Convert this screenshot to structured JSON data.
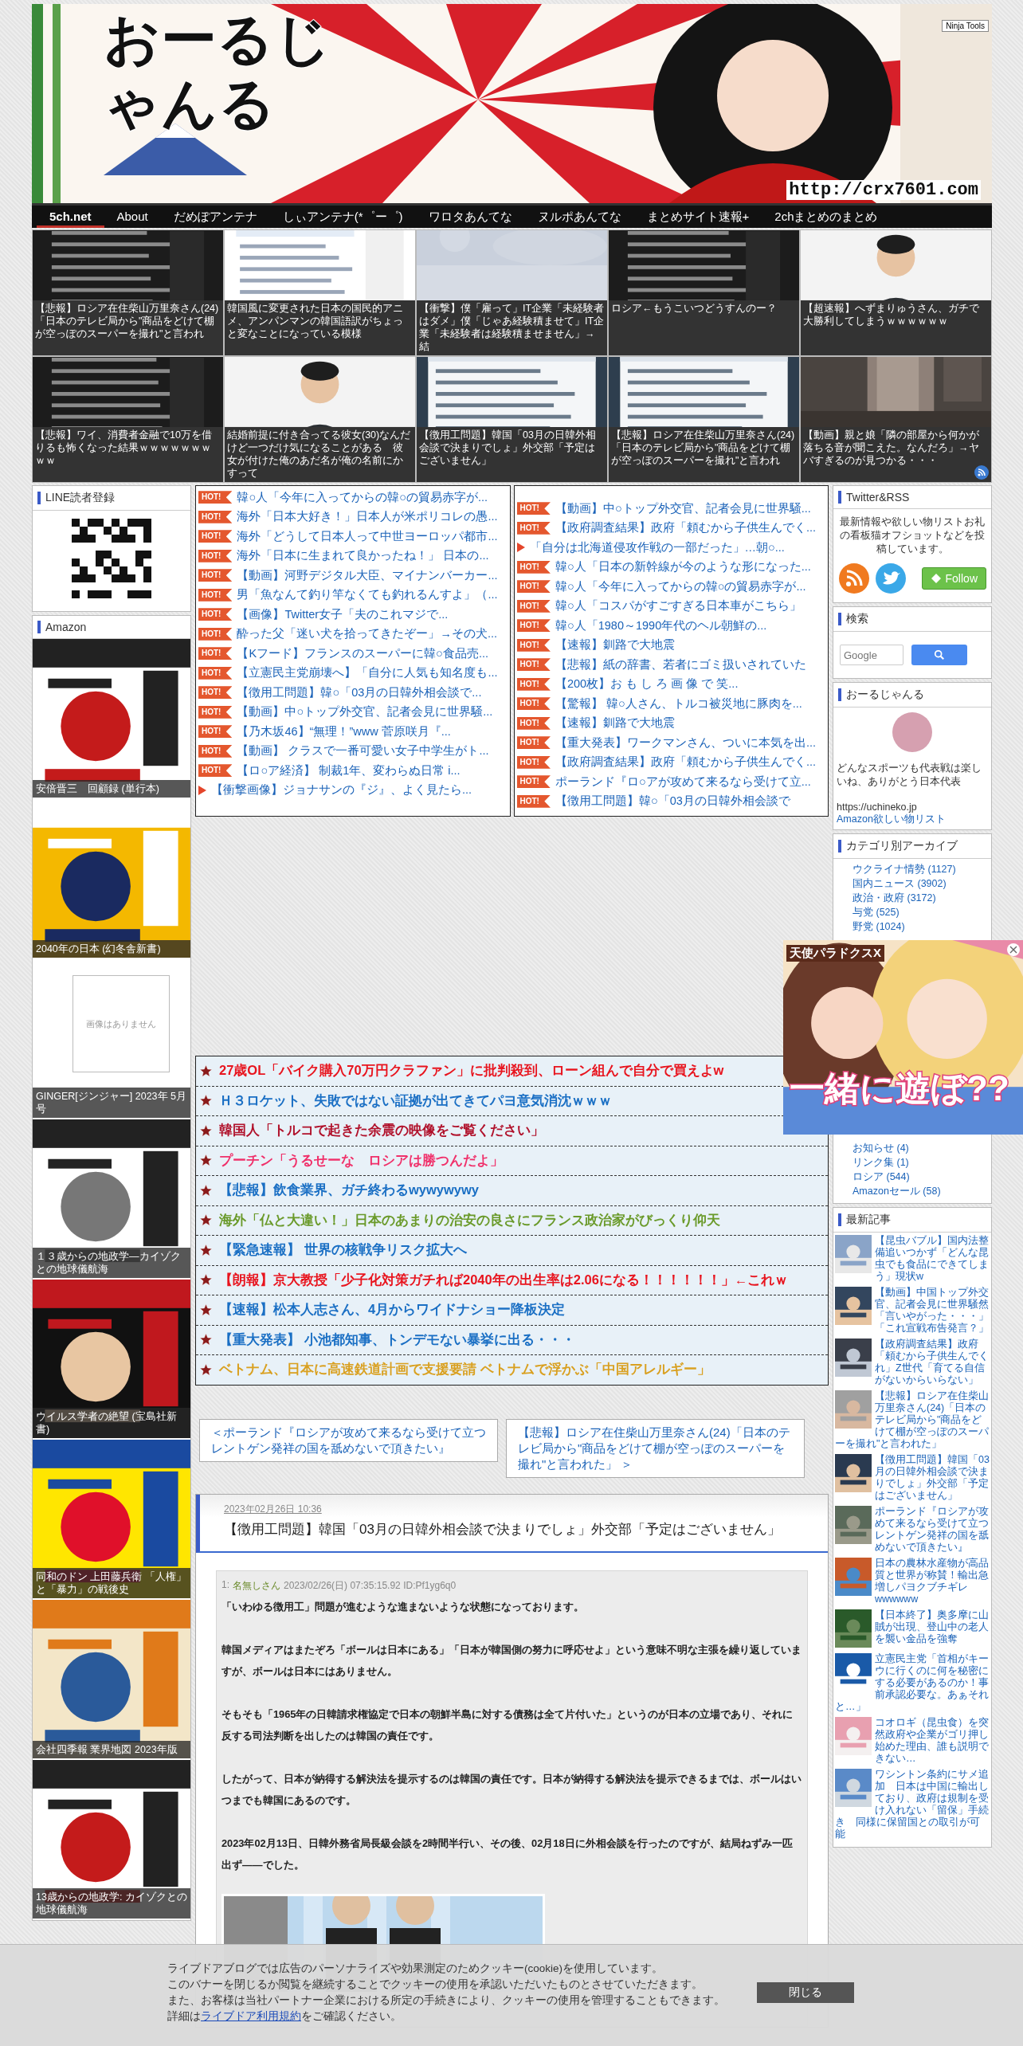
{
  "header": {
    "logo": "おーるじゃんる",
    "url": "http://crx7601.com",
    "badge": "Ninja Tools"
  },
  "nav": {
    "items": [
      {
        "label": "5ch.net",
        "selected": true
      },
      {
        "label": "About",
        "selected": false
      },
      {
        "label": "だめぽアンテナ",
        "selected": false
      },
      {
        "label": "しぃアンテナ(*゜ー゜)",
        "selected": false
      },
      {
        "label": "ワロタあんてな",
        "selected": false
      },
      {
        "label": "ヌルポあんてな",
        "selected": false
      },
      {
        "label": "まとめサイト速報+",
        "selected": false
      },
      {
        "label": "2chまとめのまとめ",
        "selected": false
      }
    ]
  },
  "featured": [
    {
      "caption": "【悲報】ロシア在住柴山万里奈さん(24)「日本のテレビ局から\"商品をどけて棚が空っぽのスーパーを撮れ\"と言われ"
    },
    {
      "caption": "韓国風に変更された日本の国民的アニメ、アンパンマンの韓国語訳がちょっと変なことになっている模様"
    },
    {
      "caption": "【衝撃】僕「雇って」IT企業「未経験者はダメ」僕「じゃあ経験積ませて」IT企業「未経験者は経験積ませません」→結"
    },
    {
      "caption": "ロシア←もうこいつどうすんのー？"
    },
    {
      "caption": "【超速報】へずまりゅうさん、ガチで大勝利してしまうｗｗｗｗｗｗ"
    },
    {
      "caption": "【悲報】ワイ、消費者金融で10万を借りるも怖くなった結果ｗｗｗｗｗｗｗｗｗ"
    },
    {
      "caption": "結婚前提に付き合ってる彼女(30)なんだけど一つだけ気になることがある　彼女が付けた俺のあだ名が俺の名前にかすって"
    },
    {
      "caption": "【徴用工問題】韓国「03月の日韓外相会談で決まりでしょ」外交部「予定はございません」"
    },
    {
      "caption": "【悲報】ロシア在住柴山万里奈さん(24)「日本のテレビ局から\"商品をどけて棚が空っぽのスーパーを撮れ\"と言われ"
    },
    {
      "caption": "【動画】親と娘「隣の部屋から何かが落ちる音が聞こえた。なんだろ」→ヤバすぎるのが見つかる・・・"
    }
  ],
  "hot_lists": [
    {
      "items": [
        {
          "kind": "hot",
          "badge": "HOT!",
          "text": "韓○人「今年に入ってからの韓○の貿易赤字が..."
        },
        {
          "kind": "hot",
          "badge": "HOT!",
          "text": "海外「日本大好き！」日本人が米ポリコレの愚..."
        },
        {
          "kind": "hot",
          "badge": "HOT!",
          "text": "海外「どうして日本人って中世ヨーロッパ都市..."
        },
        {
          "kind": "hot",
          "badge": "HOT!",
          "text": "海外「日本に生まれて良かったね！」 日本の..."
        },
        {
          "kind": "hot",
          "badge": "HOT!",
          "text": "【動画】河野デジタル大臣、マイナンバーカー..."
        },
        {
          "kind": "hot",
          "badge": "HOT!",
          "text": "男「魚なんて釣り竿なくても釣れるんすよ」（..."
        },
        {
          "kind": "hot",
          "badge": "HOT!",
          "text": "【画像】Twitter女子「夫のこれマジで..."
        },
        {
          "kind": "hot",
          "badge": "HOT!",
          "text": "酔った父「迷い犬を拾ってきたぞー」→その犬..."
        },
        {
          "kind": "hot",
          "badge": "HOT!",
          "text": "【Kフード】フランスのスーパーに韓○食品売..."
        },
        {
          "kind": "hot",
          "badge": "HOT!",
          "text": "【立憲民主党崩壊へ】「自分に人気も知名度も..."
        },
        {
          "kind": "hot",
          "badge": "HOT!",
          "text": "【徴用工問題】韓○「03月の日韓外相会談で..."
        },
        {
          "kind": "hot",
          "badge": "HOT!",
          "text": "【動画】中○トップ外交官、記者会見に世界騒..."
        },
        {
          "kind": "hot",
          "badge": "HOT!",
          "text": "【乃木坂46】“無理！”www 菅原咲月『..."
        },
        {
          "kind": "hot",
          "badge": "HOT!",
          "text": "【動画】 クラスで一番可愛い女子中学生がト..."
        },
        {
          "kind": "hot",
          "badge": "HOT!",
          "text": "【ロ○ア経済】 制裁1年、変わらぬ日常 i..."
        },
        {
          "kind": "arrow",
          "text": "【衝撃画像】ジョナサンの『ジ』、よく見たら..."
        }
      ]
    },
    {
      "items": [
        {
          "kind": "hot",
          "badge": "HOT!",
          "text": "【動画】中○トップ外交官、記者会見に世界騒..."
        },
        {
          "kind": "hot",
          "badge": "HOT!",
          "text": "【政府調査結果】政府「頼むから子供生んでく..."
        },
        {
          "kind": "arrow",
          "text": "「自分は北海道侵攻作戦の一部だった」…朝○..."
        },
        {
          "kind": "hot",
          "badge": "HOT!",
          "text": "韓○人「日本の新幹線が今のような形になった..."
        },
        {
          "kind": "hot",
          "badge": "HOT!",
          "text": "韓○人「今年に入ってからの韓○の貿易赤字が..."
        },
        {
          "kind": "hot",
          "badge": "HOT!",
          "text": "韓○人「コスパがすごすぎる日本車がこちら」"
        },
        {
          "kind": "hot",
          "badge": "HOT!",
          "text": "韓○人「1980～1990年代のヘル朝鮮の..."
        },
        {
          "kind": "hot",
          "badge": "HOT!",
          "text": "【速報】釧路で大地震"
        },
        {
          "kind": "hot",
          "badge": "HOT!",
          "text": "【悲報】紙の辞書、若者にゴミ扱いされていた"
        },
        {
          "kind": "hot",
          "badge": "HOT!",
          "text": "【200枚】お も し ろ 画 像 で 笑..."
        },
        {
          "kind": "hot",
          "badge": "HOT!",
          "text": "【驚報】 韓○人さん、トルコ被災地に豚肉を..."
        },
        {
          "kind": "hot",
          "badge": "HOT!",
          "text": "【速報】釧路で大地震"
        },
        {
          "kind": "hot",
          "badge": "HOT!",
          "text": "【重大発表】ワークマンさん、ついに本気を出..."
        },
        {
          "kind": "hot",
          "badge": "HOT!",
          "text": "【政府調査結果】政府「頼むから子供生んでく..."
        },
        {
          "kind": "hot",
          "badge": "HOT!",
          "text": "ポーランド『ロ○アが攻めて来るなら受けて立..."
        },
        {
          "kind": "hot",
          "badge": "HOT!",
          "text": "【徴用工問題】韓○「03月の日韓外相会談で"
        }
      ]
    }
  ],
  "headlines": [
    {
      "text": "27歳OL「バイク購入70万円クラファン」に批判殺到、ローン組んで自分で買えよw",
      "color": "#e8141e"
    },
    {
      "text": "Ｈ３ロケット、失敗ではない証拠が出てきてパヨ意気消沈ｗｗｗ",
      "color": "#1a6fc4"
    },
    {
      "text": "韓国人「トルコで起きた余震の映像をご覧ください」",
      "color": "#b0102a"
    },
    {
      "text": "プーチン「うるせーな　ロシアは勝つんだよ」",
      "color": "#f0306a"
    },
    {
      "text": "【悲報】飲食業界、ガチ終わるwywywywy",
      "color": "#1a6fc4"
    },
    {
      "text": "海外「仏と大違い！」日本のあまりの治安の良さにフランス政治家がびっくり仰天",
      "color": "#6a9a2a"
    },
    {
      "text": "【緊急速報】 世界の核戦争リスク拡大へ",
      "color": "#1a6fc4"
    },
    {
      "text": "【朗報】京大教授「少子化対策ガチれば2040年の出生率は2.06になる！！！！！！」←これｗ",
      "color": "#e8141e"
    },
    {
      "text": "【速報】松本人志さん、4月からワイドナショー降板決定",
      "color": "#1a6fc4"
    },
    {
      "text": "【重大発表】 小池都知事、トンデモない暴挙に出る・・・",
      "color": "#1a6fc4"
    },
    {
      "text": "ベトナム、日本に高速鉄道計画で支援要請 ベトナムで浮かぶ「中国アレルギー」",
      "color": "#d9a020"
    }
  ],
  "pager": {
    "prev": "＜ポーランド『ロシアが攻めて来るなら受けて立つレントゲン発祥の国を舐めないで頂きたい』",
    "next": "【悲報】ロシア在住柴山万里奈さん(24)「日本のテレビ局から\"商品をどけて棚が空っぽのスーパーを撮れ\"と言われた」 ＞"
  },
  "article": {
    "date": "2023年02月26日 10:36",
    "title": "【徴用工問題】韓国「03月の日韓外相会談で決まりでしょ」外交部「予定はございません」",
    "post": {
      "number": "1:",
      "name": "名無しさん",
      "meta": "2023/02/26(日) 07:35:15.92 ID:Pf1yg6q0",
      "paragraphs": [
        "「いわゆる徴用工」問題が進むような進まないような状態になっております。",
        "韓国メディアはまたぞろ「ボールは日本にある」「日本が韓国側の努力に呼応せよ」という意味不明な主張を繰り返していますが、ボールは日本にはありません。",
        "そもそも「1965年の日韓請求権協定で日本の朝鮮半島に対する債務は全て片付いた」というのが日本の立場であり、それに反する司法判断を出したのは韓国の責任です。",
        "したがって、日本が納得する解決法を提示するのは韓国の責任です。日本が納得する解決法を提示できるまでは、ボールはいつまでも韓国にあるのです。",
        "2023年02月13日、日韓外務省局長級会談を2時間半行い、その後、02月18日に外相会談を行ったのですが、結局ねずみ一匹出ず――でした。"
      ]
    }
  },
  "left_sidebar": {
    "line": {
      "title": "LINE読者登録"
    },
    "amazon": {
      "title": "Amazon",
      "books": [
        {
          "kind": "cover",
          "title": "安倍晋三　回顧録 (単行本)"
        },
        {
          "kind": "cover",
          "title": "2040年の日本 (幻冬舎新書)"
        },
        {
          "kind": "no_image",
          "no_image_text": "画像はありません",
          "title": "GINGER[ジンジャー] 2023年 5月号"
        },
        {
          "kind": "cover",
          "title": "１３歳からの地政学―カイゾクとの地球儀航海"
        },
        {
          "kind": "cover",
          "title": "ウイルス学者の絶望 (宝島社新書)"
        },
        {
          "kind": "cover",
          "title": "同和のドン 上田藤兵衛 「人権」と「暴力」の戦後史"
        },
        {
          "kind": "cover",
          "title": "会社四季報 業界地図 2023年版"
        },
        {
          "kind": "cover",
          "title": "13歳からの地政学: カイゾクとの地球儀航海"
        }
      ]
    }
  },
  "right_sidebar": {
    "twitter": {
      "title": "Twitter&RSS",
      "text": "最新情報や欲しい物リストお礼の看板猫オフショットなどを投稿しています。",
      "follow": "Follow"
    },
    "search": {
      "title": "検索",
      "placeholder": "Google"
    },
    "profile": {
      "title": "おーるじゃんる",
      "text": "どんなスポーツも代表戦は楽しいね、ありがとう日本代表",
      "url": "https://uchineko.jp",
      "link": "Amazon欲しい物リスト"
    },
    "categories": {
      "title": "カテゴリ別アーカイブ",
      "items": [
        "ウクライナ情勢 (1127)",
        "国内ニュース (3902)",
        "政治・政府 (3172)",
        "与党 (525)",
        "野党 (1024)"
      ],
      "after_ad": [
        "お知らせ (4)",
        "リンク集 (1)",
        "ロシア (544)",
        "Amazonセール (58)"
      ]
    },
    "latest": {
      "title": "最新記事",
      "items": [
        "【昆虫バブル】国内法整備追いつかず「どんな昆虫でも食品にできてしまう」現状w",
        "【動画】中国トップ外交官、記者会見に世界騒然「言いやがった・・・」「これ宣戦布告発言？」",
        "【政府調査結果】政府「頼むから子供生んでくれ」Z世代「育てる自信がないからいらない」",
        "【悲報】ロシア在住柴山万里奈さん(24)「日本のテレビ局から\"商品をどけて棚が空っぽのスーパーを撮れ\"と言われた」",
        "【徴用工問題】韓国「03月の日韓外相会談で決まりでしょ」外交部「予定はございません」",
        "ポーランド『ロシアが攻めて来るなら受けて立つレントゲン発祥の国を舐めないで頂きたい』",
        "日本の農林水産物が高品質と世界が称賛！輸出急増しパヨクブチギレwwwwww",
        "【日本終了】奥多摩に山賊が出現、登山中の老人を襲い金品を強奪",
        "立憲民主党「首相がキーウに行くのに何を秘密にする必要があるのか！事前承認必要な。あぁそれと…」",
        "コオロギ（昆虫食）を突然政府や企業がゴリ押し始めた理由、誰も説明できない…",
        "ワシントン条約にサメ追加　日本は中国に輸出しており、政府は規制を受け入れない「留保」手続き　同様に保留国との取引が可能"
      ]
    }
  },
  "ad": {
    "title": "天使パラドクスX",
    "tagline": "一緒に遊ぼ??"
  },
  "cookie": {
    "lines": [
      "ライブドアブログでは広告のパーソナライズや効果測定のためクッキー(cookie)を使用しています。",
      "このバナーを閉じるか閲覧を継続することでクッキーの使用を承認いただいたものとさせていただきます。",
      "また、お客様は当社パートナー企業における所定の手続きにより、クッキーの使用を管理することもできます。"
    ],
    "detail_before": "詳細は",
    "link": "ライブドア利用規約",
    "detail_after": "をご確認ください。",
    "button": "閉じる"
  }
}
